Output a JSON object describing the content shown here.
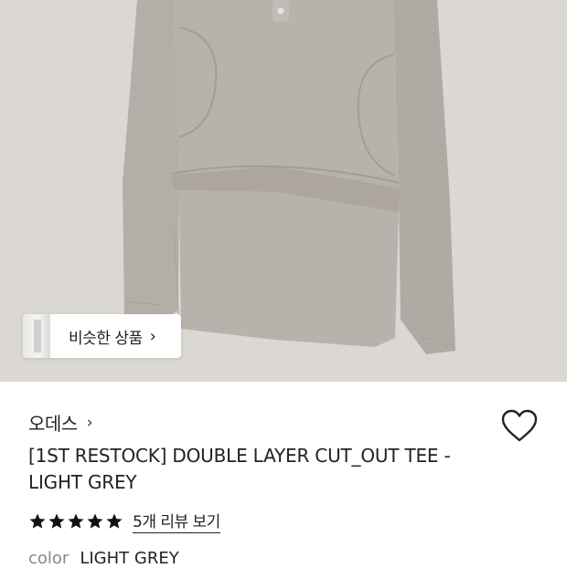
{
  "similar_products": {
    "label": "비슷한 상품"
  },
  "brand": {
    "name": "오데스"
  },
  "product": {
    "title": "[1ST RESTOCK] DOUBLE LAYER CUT_OUT TEE - LIGHT GREY"
  },
  "rating": {
    "stars": 5,
    "review_link": "5개 리뷰 보기"
  },
  "option": {
    "label": "color",
    "value": "LIGHT GREY"
  },
  "colors": {
    "hero_background": "#dbd8d3",
    "garment": "#b2aca6",
    "text": "#222222"
  },
  "icons": [
    "chevron-right-icon",
    "heart-icon",
    "star-icon"
  ]
}
